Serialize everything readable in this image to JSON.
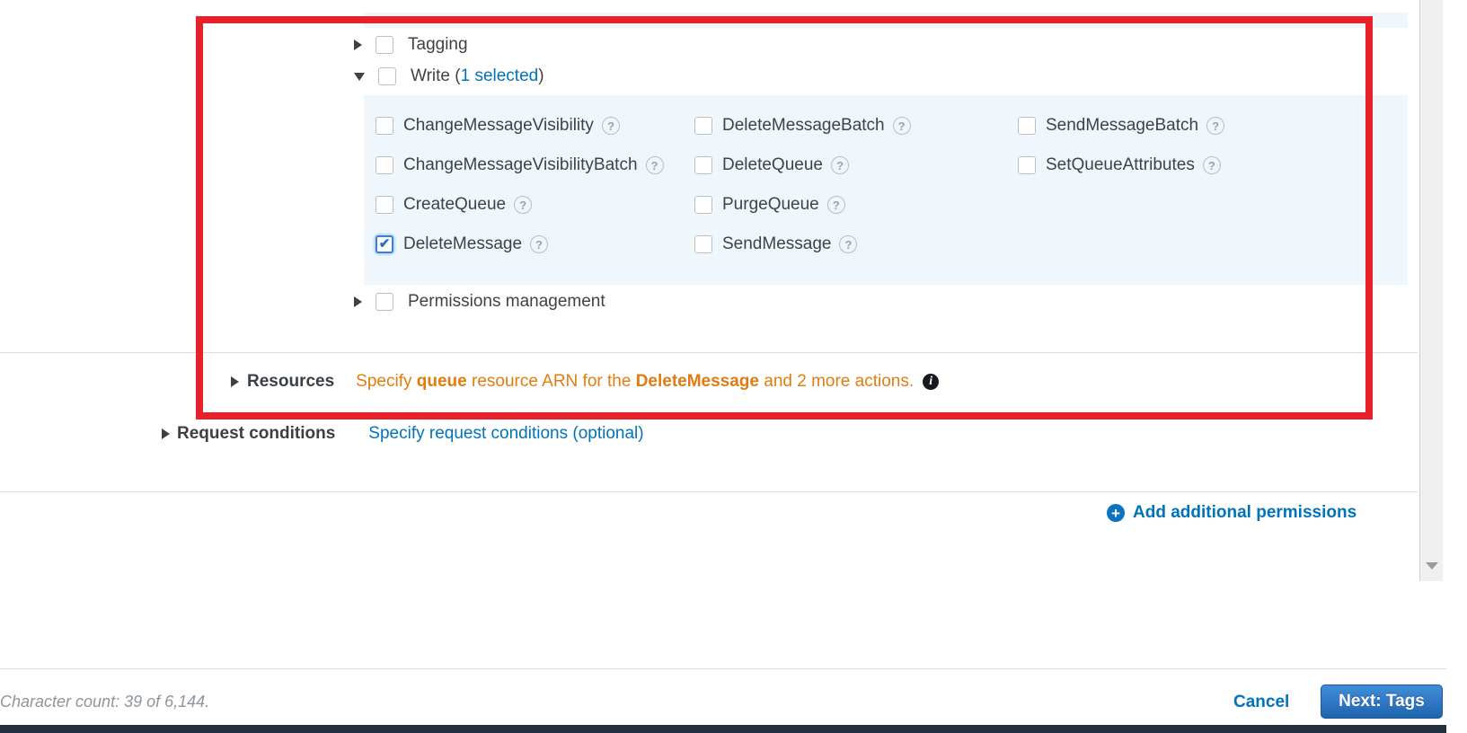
{
  "colors": {
    "link_blue": "#0073bb",
    "warning_orange": "#e07c10",
    "panel_blue": "#eff7fd",
    "highlight_red": "#e8202a",
    "primary_button_blue": "#1f63ae",
    "console_bar_navy": "#222f3e"
  },
  "icons": {
    "help": "?",
    "info": "i",
    "plus": "+"
  },
  "categories": {
    "tagging": "Tagging",
    "write_prefix": "Write (",
    "write_selected_link": "1 selected",
    "write_suffix": ")",
    "permissions_management": "Permissions management"
  },
  "write_actions": {
    "col1": [
      {
        "label": "ChangeMessageVisibility",
        "checked": false
      },
      {
        "label": "ChangeMessageVisibilityBatch",
        "checked": false
      },
      {
        "label": "CreateQueue",
        "checked": false
      },
      {
        "label": "DeleteMessage",
        "checked": true
      }
    ],
    "col2": [
      {
        "label": "DeleteMessageBatch",
        "checked": false
      },
      {
        "label": "DeleteQueue",
        "checked": false
      },
      {
        "label": "PurgeQueue",
        "checked": false
      },
      {
        "label": "SendMessage",
        "checked": false
      }
    ],
    "col3": [
      {
        "label": "SendMessageBatch",
        "checked": false
      },
      {
        "label": "SetQueueAttributes",
        "checked": false
      }
    ]
  },
  "resources": {
    "label": "Resources",
    "hint_pre": "Specify ",
    "hint_bold_1": "queue",
    "hint_mid": " resource ARN for the ",
    "hint_bold_2": "DeleteMessage",
    "hint_post": " and 2 more actions."
  },
  "request_conditions": {
    "label": "Request conditions",
    "link": "Specify request conditions (optional)"
  },
  "add_permissions": {
    "label": "Add additional permissions"
  },
  "footer": {
    "character_count": "Character count: 39 of 6,144.",
    "cancel_label": "Cancel",
    "next_label": "Next: Tags"
  }
}
